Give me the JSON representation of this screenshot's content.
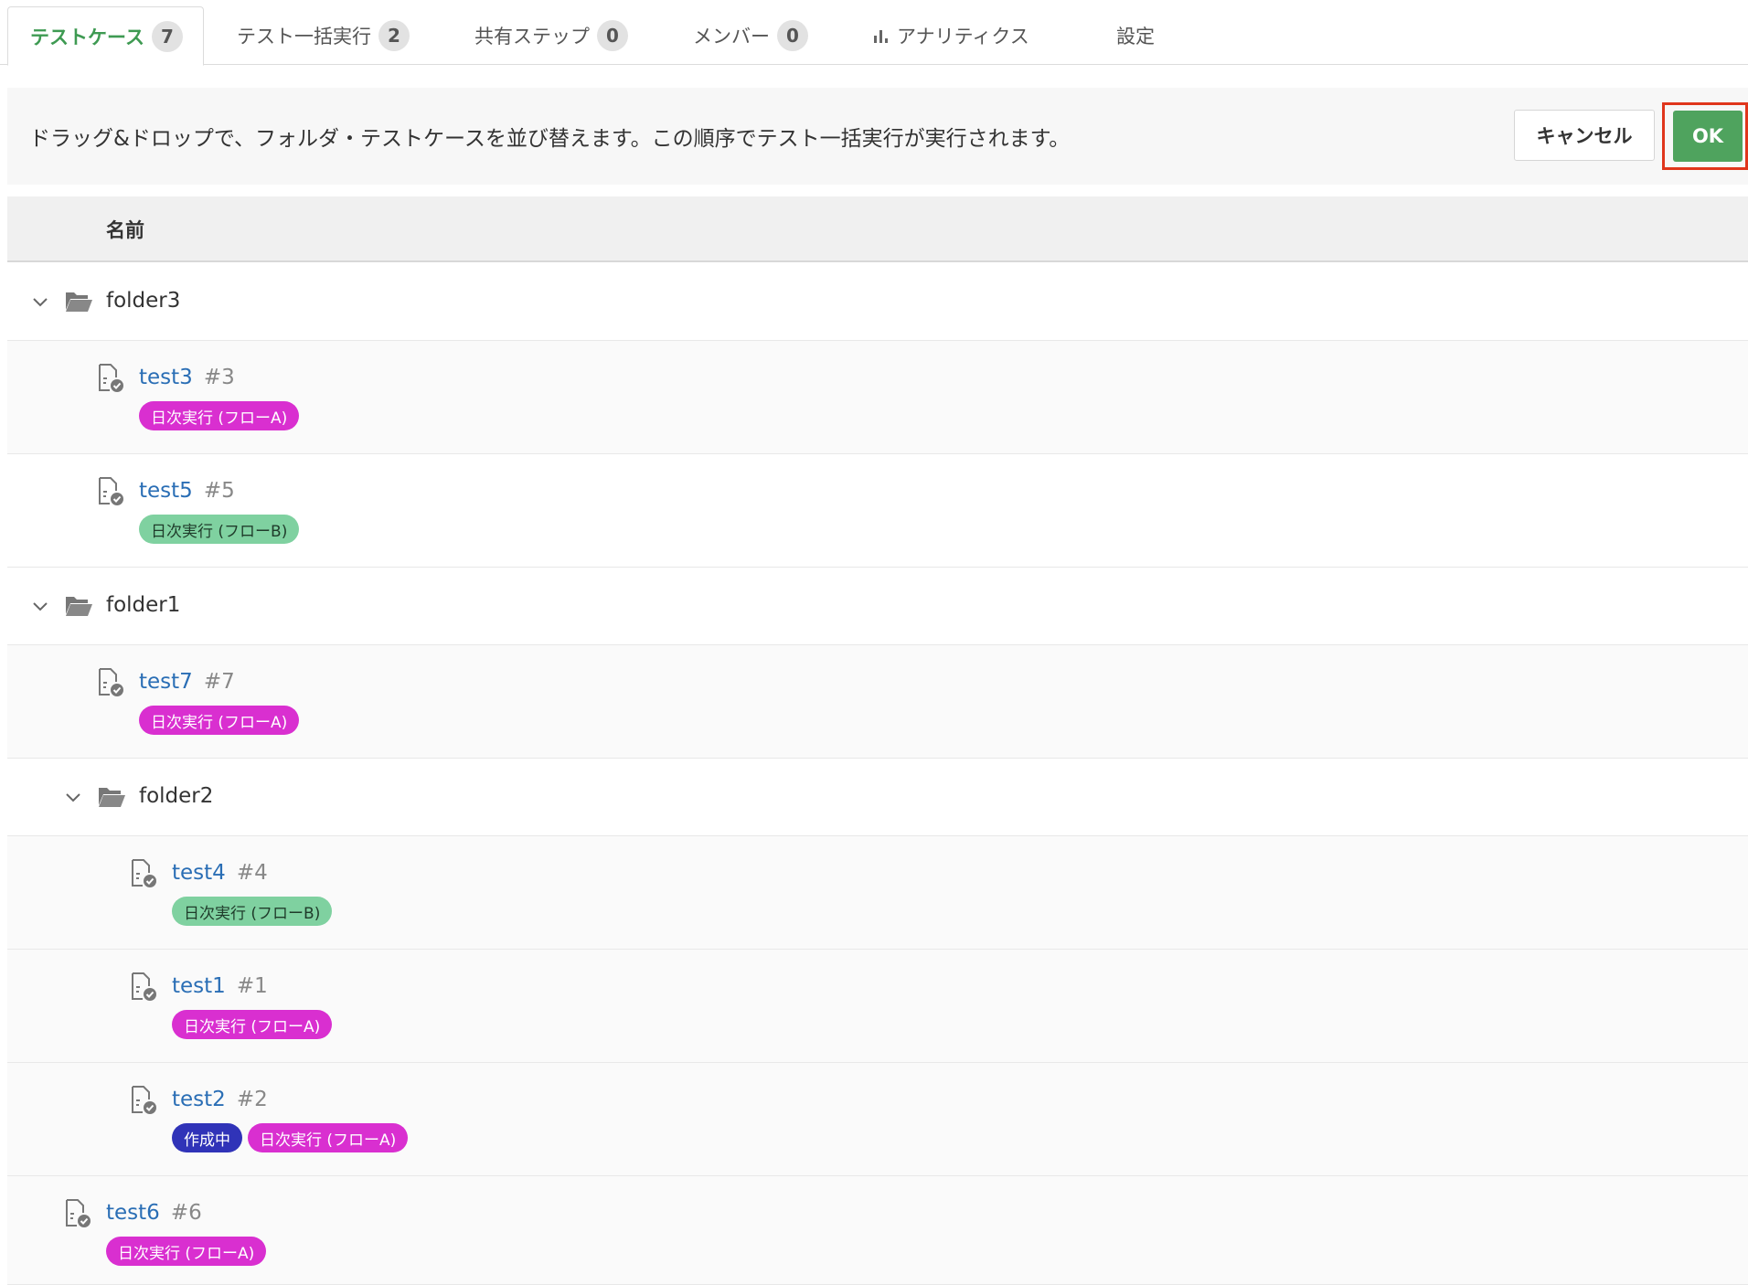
{
  "tabs": [
    {
      "label": "テストケース",
      "count": "7",
      "active": true
    },
    {
      "label": "テスト一括実行",
      "count": "2"
    },
    {
      "label": "共有ステップ",
      "count": "0"
    },
    {
      "label": "メンバー",
      "count": "0"
    },
    {
      "label": "アナリティクス",
      "icon": "bar-chart-icon"
    },
    {
      "label": "設定"
    }
  ],
  "infobar": {
    "message": "ドラッグ&ドロップで、フォルダ・テストケースを並び替えます。この順序でテスト一括実行が実行されます。",
    "cancel_label": "キャンセル",
    "ok_label": "OK"
  },
  "table": {
    "header_name": "名前"
  },
  "tree": {
    "folder3": {
      "name": "folder3"
    },
    "test3": {
      "name": "test3",
      "num": "#3",
      "labels": [
        {
          "text": "日次実行 (フローA)",
          "color": "#d92fd0"
        }
      ]
    },
    "test5": {
      "name": "test5",
      "num": "#5",
      "labels": [
        {
          "text": "日次実行 (フローB)",
          "color": "#7fd1a0"
        }
      ]
    },
    "folder1": {
      "name": "folder1"
    },
    "test7": {
      "name": "test7",
      "num": "#7",
      "labels": [
        {
          "text": "日次実行 (フローA)",
          "color": "#d92fd0"
        }
      ]
    },
    "folder2": {
      "name": "folder2"
    },
    "test4": {
      "name": "test4",
      "num": "#4",
      "labels": [
        {
          "text": "日次実行 (フローB)",
          "color": "#7fd1a0"
        }
      ]
    },
    "test1": {
      "name": "test1",
      "num": "#1",
      "labels": [
        {
          "text": "日次実行 (フローA)",
          "color": "#d92fd0"
        }
      ]
    },
    "test2": {
      "name": "test2",
      "num": "#2",
      "labels": [
        {
          "text": "作成中",
          "color": "#3033b8"
        },
        {
          "text": "日次実行 (フローA)",
          "color": "#d92fd0"
        }
      ]
    },
    "test6": {
      "name": "test6",
      "num": "#6",
      "labels": [
        {
          "text": "日次実行 (フローA)",
          "color": "#d92fd0"
        }
      ]
    }
  }
}
